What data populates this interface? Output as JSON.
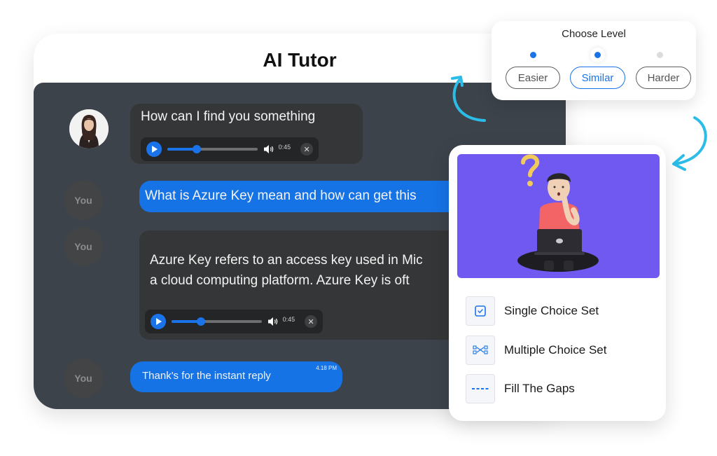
{
  "app": {
    "title": "AI Tutor"
  },
  "chat": {
    "messages": [
      {
        "sender": "tutor",
        "avatar": "tutor-photo",
        "text": "How can I find you something",
        "audio": {
          "progress": 0.33,
          "duration": "0:45"
        }
      },
      {
        "sender": "user",
        "avatar_label": "You",
        "text": "What is Azure Key mean and how can get this"
      },
      {
        "sender": "tutor",
        "avatar_label": "You",
        "text_line1": "Azure Key refers to an access key used in Mic",
        "text_line2": "a cloud computing platform. Azure Key is oft",
        "audio": {
          "progress": 0.33,
          "duration": "0:45"
        }
      },
      {
        "sender": "user",
        "avatar_label": "You",
        "text": "Thank's for the instant reply",
        "timestamp": "4.18 PM"
      }
    ]
  },
  "level_selector": {
    "title": "Choose Level",
    "options": [
      {
        "label": "Easier",
        "selected": false,
        "dot_color": "#1a73e8"
      },
      {
        "label": "Similar",
        "selected": true,
        "dot_color": "#1a73e8"
      },
      {
        "label": "Harder",
        "selected": false,
        "dot_color": "#dcdcdc"
      }
    ]
  },
  "quiz_types": {
    "items": [
      {
        "label": "Single Choice Set",
        "icon": "checkbox-icon"
      },
      {
        "label": "Multiple Choice Set",
        "icon": "multiple-choice-icon"
      },
      {
        "label": "Fill The Gaps",
        "icon": "dashes-icon"
      }
    ]
  },
  "colors": {
    "accent": "#1a73e8",
    "chat_bg": "#3d434b",
    "bubble_dark": "#353637",
    "illustration_bg": "#7059f0",
    "arrow": "#2bbde8"
  }
}
